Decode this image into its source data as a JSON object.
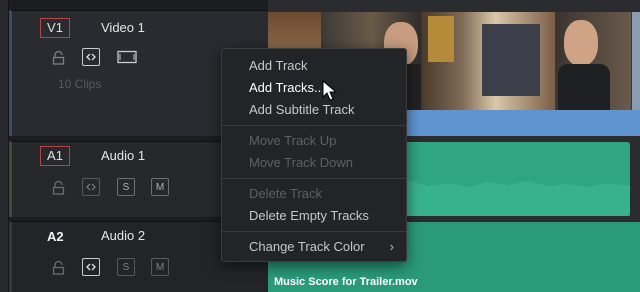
{
  "tracks": {
    "video": {
      "badge": "V1",
      "name": "Video 1",
      "clip_count": "10 Clips"
    },
    "a1": {
      "badge": "A1",
      "name": "Audio 1",
      "solo": "S",
      "mute": "M"
    },
    "a2": {
      "badge": "A2",
      "name": "Audio 2",
      "solo": "S",
      "mute": "M"
    }
  },
  "timeline": {
    "audio_clip_2_name": "Music Score for Trailer.mov",
    "video_clip_color": "#5f94d0",
    "audio_clip_color": "#2fa582"
  },
  "context_menu": {
    "items": [
      {
        "label": "Add Track",
        "enabled": true
      },
      {
        "label": "Add Tracks...",
        "enabled": true,
        "highlighted": true
      },
      {
        "label": "Add Subtitle Track",
        "enabled": true
      },
      {
        "label": "Move Track Up",
        "enabled": false
      },
      {
        "label": "Move Track Down",
        "enabled": false
      },
      {
        "label": "Delete Track",
        "enabled": false
      },
      {
        "label": "Delete Empty Tracks",
        "enabled": true
      },
      {
        "label": "Change Track Color",
        "enabled": true,
        "submenu": true
      }
    ]
  },
  "icons": [
    "lock-icon",
    "auto-select-icon",
    "monitor-icon",
    "cursor-icon",
    "submenu-arrow-icon"
  ]
}
